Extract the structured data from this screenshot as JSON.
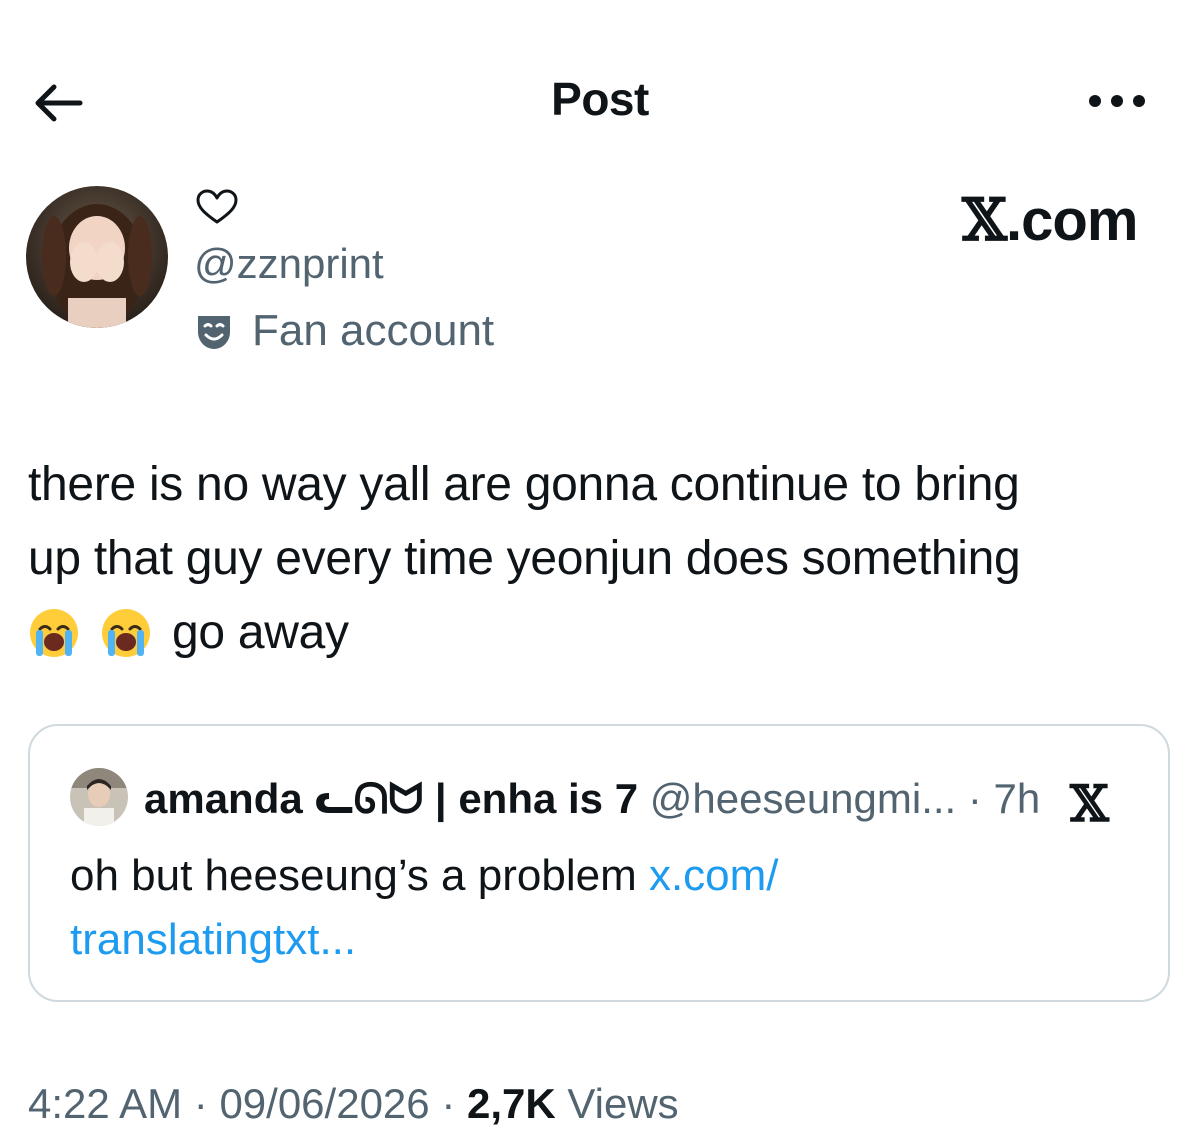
{
  "header": {
    "title": "Post"
  },
  "author": {
    "display_name": "♡",
    "handle": "@zznprint",
    "label": "Fan account"
  },
  "watermark": {
    "x_letter": "𝕏",
    "suffix": ".com"
  },
  "post": {
    "line1": "there is no way yall are gonna continue to bring",
    "line2": "up that guy every time yeonjun does something",
    "line3_text": "go away",
    "emoji": "loudly-crying-face"
  },
  "quote": {
    "name": "amanda ᓚᘏᗢ | enha is 7",
    "handle": "@heeseungmi...",
    "time": "· 7h",
    "text": "oh but heeseung’s a problem ",
    "link_line1": "x.com/",
    "link_line2": "translatingtxt..."
  },
  "meta": {
    "time": "4:22 AM",
    "sep1": " · ",
    "date": "09/06/2026",
    "sep2": " · ",
    "views_count": "2,7K",
    "views_label": " Views"
  },
  "colors": {
    "text": "#0f1419",
    "secondary": "#536471",
    "link": "#1d9bf0",
    "border": "#cfd9de"
  }
}
